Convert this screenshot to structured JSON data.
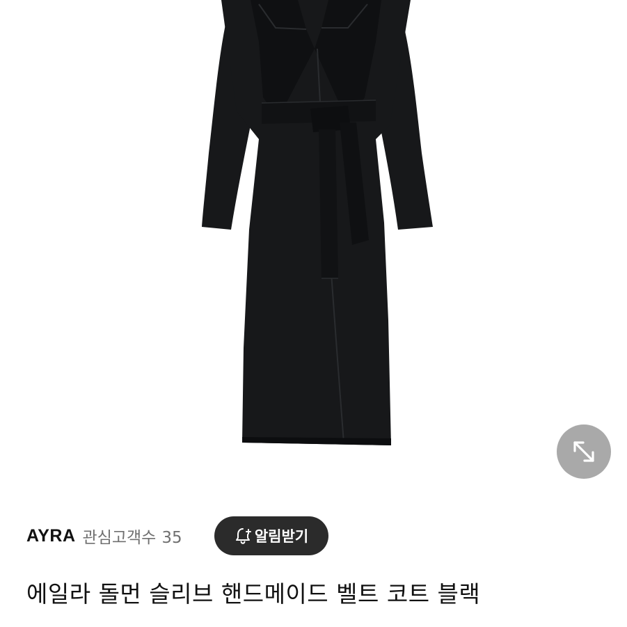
{
  "product_image": {
    "expand_icon": "expand-arrows-icon"
  },
  "seller": {
    "name": "AYRA",
    "followers_label": "관심고객수",
    "followers_count": "35"
  },
  "notify_button": {
    "label": "알림받기",
    "icon": "bell-plus-icon"
  },
  "product": {
    "title": "에일라 돌먼 슬리브 핸드메이드 벨트 코트 블랙"
  },
  "colors": {
    "coat": "#17181a",
    "button_dark": "#2b2b2b",
    "expand_button": "#a9a9a9",
    "muted_text": "#707070"
  }
}
